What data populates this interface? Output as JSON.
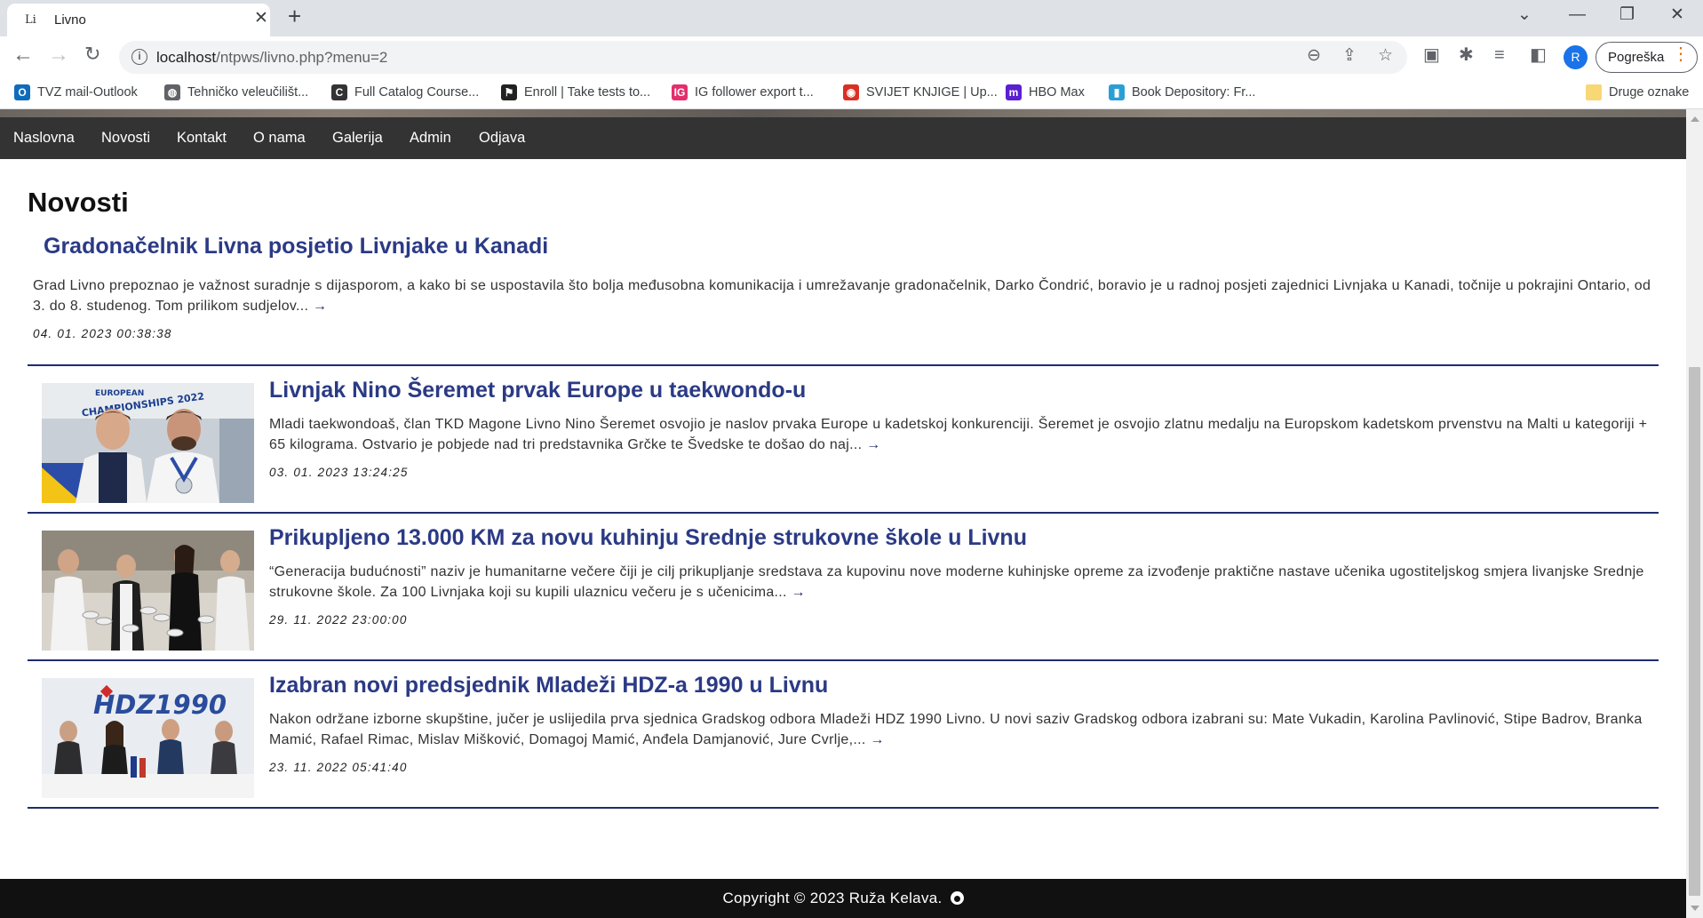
{
  "browser": {
    "tab_favicon": "Li",
    "tab_title": "Livno",
    "url_host": "localhost",
    "url_path": "/ntpws/livno.php?menu=2",
    "profile_initial": "R",
    "error_button": "Pogreška"
  },
  "bookmarks": [
    {
      "label": "TVZ mail-Outlook",
      "icon": "outlook-icon",
      "color": "#0f6cbd"
    },
    {
      "label": "Tehničko veleučilišt...",
      "icon": "globe-icon",
      "color": "#5f6368"
    },
    {
      "label": "Full Catalog Course...",
      "icon": "catalog-icon",
      "color": "#333333"
    },
    {
      "label": "Enroll | Take tests to...",
      "icon": "enroll-icon",
      "color": "#222222"
    },
    {
      "label": "IG follower export t...",
      "icon": "ig-export-icon",
      "color": "#e1306c"
    },
    {
      "label": "SVIJET KNJIGE | Up...",
      "icon": "svijet-knjige-icon",
      "color": "#d93025"
    },
    {
      "label": "HBO Max",
      "icon": "hbo-max-icon",
      "color": "#5a1fd1"
    },
    {
      "label": "Book Depository: Fr...",
      "icon": "book-depository-icon",
      "color": "#2a9fd6"
    }
  ],
  "other_bookmarks": "Druge oznake",
  "nav": [
    "Naslovna",
    "Novosti",
    "Kontakt",
    "O nama",
    "Galerija",
    "Admin",
    "Odjava"
  ],
  "page_title": "Novosti",
  "articles": [
    {
      "title": "Gradonačelnik Livna posjetio Livnjake u Kanadi",
      "excerpt": "Grad Livno prepoznao je važnost suradnje s dijasporom, a kako bi se uspostavila što bolja međusobna komunikacija i umrežavanje gradonačelnik, Darko Čondrić, boravio je u radnoj posjeti zajednici Livnjaka u Kanadi, točnije u pokrajini Ontario, od 3. do 8. studenog. Tom prilikom sudjelov...",
      "date": "04. 01. 2023 00:38:38",
      "has_image": false
    },
    {
      "title": "Livnjak Nino Šeremet prvak Europe u taekwondo-u",
      "excerpt": "Mladi taekwondoaš, član TKD Magone Livno Nino Šeremet osvojio je naslov prvaka Europe u kadetskoj konkurenciji. Šeremet je osvojio zlatnu medalju na Europskom kadetskom prvenstvu na Malti u kategoriji + 65 kilograma. Ostvario je pobjede nad tri predstavnika Grčke te Švedske te došao do naj...",
      "date": "03. 01. 2023 13:24:25",
      "has_image": true,
      "image_text": "EUROPEAN CHAMPIONSHIPS 2022"
    },
    {
      "title": "Prikupljeno 13.000 KM za novu kuhinju Srednje strukovne škole u Livnu",
      "excerpt": "“Generacija budućnosti” naziv je humanitarne večere čiji je cilj prikupljanje sredstava za kupovinu nove moderne kuhinjske opreme za izvođenje praktične nastave učenika ugostiteljskog smjera livanjske Srednje strukovne škole. Za 100 Livnjaka koji su kupili ulaznicu večeru je s učenicima...",
      "date": "29. 11. 2022 23:00:00",
      "has_image": true
    },
    {
      "title": "Izabran novi predsjednik Mladeži HDZ-a 1990 u Livnu",
      "excerpt": "Nakon održane izborne skupštine, jučer je uslijedila prva sjednica Gradskog odbora Mladeži HDZ 1990 Livno. U novi saziv Gradskog odbora izabrani su: Mate Vukadin, Karolina Pavlinović, Stipe Badrov, Branka Mamić, Rafael Rimac, Mislav Mišković, Domagoj Mamić, Anđela Damjanović, Jure Cvrlje,...",
      "date": "23. 11. 2022 05:41:40",
      "has_image": true,
      "image_text": "HDZ1990"
    }
  ],
  "footer": "Copyright © 2023 Ruža Kelava.",
  "colors": {
    "navbar_bg": "#333333",
    "title_blue": "#2b3a85",
    "divider": "#1f2c6e",
    "footer_bg": "#111111"
  }
}
